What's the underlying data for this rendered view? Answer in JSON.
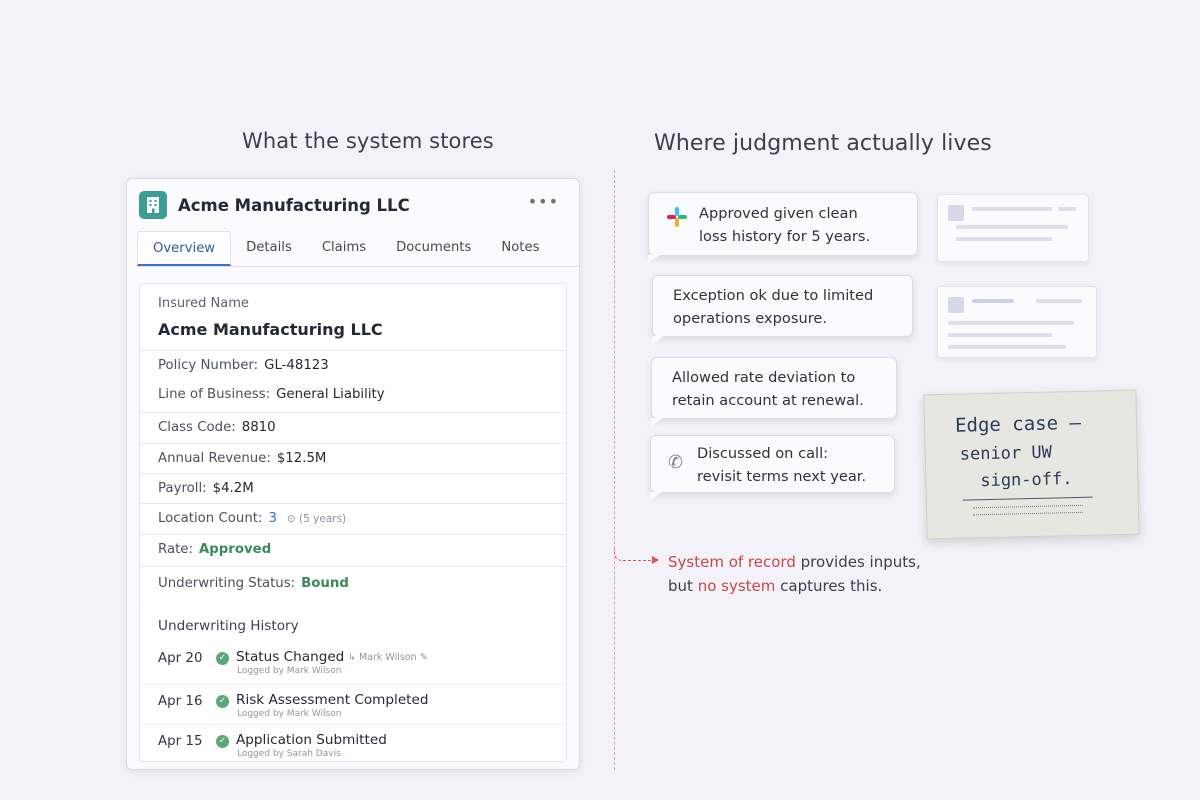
{
  "headings": {
    "left": "What the system stores",
    "right": "Where judgment actually lives"
  },
  "record": {
    "title": "Acme Manufacturing LLC",
    "more_label": "•••",
    "tabs": [
      "Overview",
      "Details",
      "Claims",
      "Documents",
      "Notes"
    ],
    "active_tab": "Overview",
    "insured_name_label": "Insured Name",
    "insured_name": "Acme Manufacturing LLC",
    "fields": [
      {
        "label": "Policy Number:",
        "value": "GL-48123"
      },
      {
        "label": "Line of Business:",
        "value": "General Liability"
      },
      {
        "label": "Class Code:",
        "value": "8810"
      },
      {
        "label": "Annual Revenue:",
        "value": "$12.5M"
      },
      {
        "label": "Payroll:",
        "value": "$4.2M"
      },
      {
        "label": "Location Count:",
        "value": "3",
        "note": "⊙ (5 years)"
      },
      {
        "label": "Rate:",
        "value": "Approved"
      },
      {
        "label": "Underwriting Status:",
        "value": "Bound"
      }
    ],
    "history_title": "Underwriting History",
    "history": [
      {
        "date": "Apr 20",
        "event": "Status Changed",
        "logged": "Logged by Mark Wilson",
        "extra": "↳ Mark Wilson ✎"
      },
      {
        "date": "Apr 16",
        "event": "Risk Assessment Completed",
        "logged": "Logged by Mark Wilson"
      },
      {
        "date": "Apr 15",
        "event": "Application Submitted",
        "logged": "Logged by Sarah Davis"
      }
    ]
  },
  "messages": [
    {
      "line1": "Approved given clean",
      "line2": "loss history for 5 years.",
      "icon": "slack-icon"
    },
    {
      "line1": "Exception ok due to limited",
      "line2": "operations exposure."
    },
    {
      "line1": "Allowed rate deviation to",
      "line2": "retain account at renewal."
    },
    {
      "line1": "Discussed on call:",
      "line2": "revisit terms next year.",
      "icon": "phone-icon"
    }
  ],
  "sticky_note": {
    "line1": "Edge case –",
    "line2": "senior UW",
    "line3": "sign-off."
  },
  "caption": {
    "part1": "System of record",
    "part2": " provides inputs,",
    "part3": "but ",
    "part4": "no system",
    "part5": " captures this."
  },
  "colors": {
    "accent_blue": "#3e6fc9",
    "status_green": "#3c8a5b",
    "highlight_red": "#c74848",
    "logo_teal": "#3b9d93"
  }
}
